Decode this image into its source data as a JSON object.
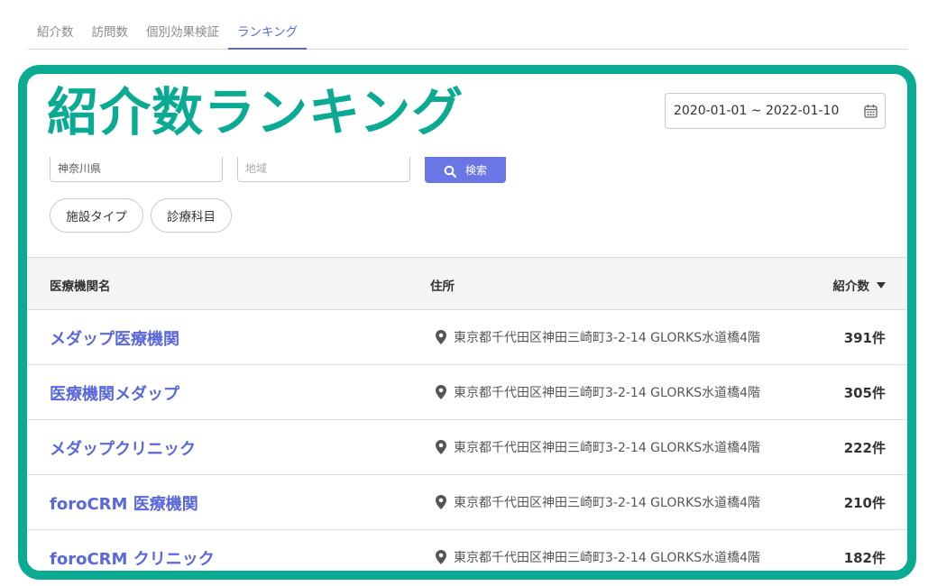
{
  "tabs": [
    {
      "label": "紹介数"
    },
    {
      "label": "訪問数"
    },
    {
      "label": "個別効果検証"
    },
    {
      "label": "ランキング"
    }
  ],
  "title": "紹介数ランキング",
  "date_range": {
    "value": "2020-01-01 ~ 2022-01-10",
    "icon": "calendar-icon"
  },
  "search": {
    "prefecture_value": "神奈川県",
    "area_placeholder": "地域",
    "button_label": "検索",
    "button_icon": "search-icon"
  },
  "filters": {
    "facility_type": "施設タイプ",
    "department": "診療科目"
  },
  "table": {
    "headers": {
      "name": "医療機関名",
      "address": "住所",
      "count": "紹介数"
    },
    "rows": [
      {
        "name": "メダップ医療機関",
        "address": "東京都千代田区神田三崎町3-2-14 GLORKS水道橋4階",
        "count": "391件"
      },
      {
        "name": "医療機関メダップ",
        "address": "東京都千代田区神田三崎町3-2-14 GLORKS水道橋4階",
        "count": "305件"
      },
      {
        "name": "メダップクリニック",
        "address": "東京都千代田区神田三崎町3-2-14 GLORKS水道橋4階",
        "count": "222件"
      },
      {
        "name": "foroCRM 医療機関",
        "address": "東京都千代田区神田三崎町3-2-14 GLORKS水道橋4階",
        "count": "210件"
      },
      {
        "name": "foroCRM クリニック",
        "address": "東京都千代田区神田三崎町3-2-14 GLORKS水道橋4階",
        "count": "182件"
      }
    ]
  },
  "colors": {
    "accent": "#5a68dc",
    "highlight": "#0aaa93",
    "button": "#6a76e4"
  }
}
